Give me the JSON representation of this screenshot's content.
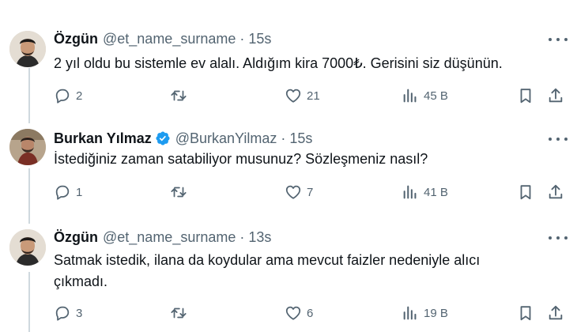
{
  "tweets": [
    {
      "name": "Özgün",
      "handle": "@et_name_surname",
      "dot": "·",
      "time": "15s",
      "verified": false,
      "text_lines": [
        "2 yıl oldu bu sistemle ev alalı. Aldığım kira 7000₺. Gerisini siz düşünün."
      ],
      "replies": "2",
      "retweets": "",
      "likes": "21",
      "views": "45 B"
    },
    {
      "name": "Burkan Yılmaz",
      "handle": "@BurkanYilmaz",
      "dot": "·",
      "time": "15s",
      "verified": true,
      "text_lines": [
        "İstediğiniz zaman satabiliyor musunuz? Sözleşmeniz nasıl?"
      ],
      "replies": "1",
      "retweets": "",
      "likes": "7",
      "views": "41 B"
    },
    {
      "name": "Özgün",
      "handle": "@et_name_surname",
      "dot": "·",
      "time": "13s",
      "verified": false,
      "text_lines": [
        "Satmak istedik, ilana da koydular ama  mevcut faizler nedeniyle alıcı",
        "çıkmadı."
      ],
      "replies": "3",
      "retweets": "",
      "likes": "6",
      "views": "19 B"
    }
  ],
  "icons": {
    "reply": "reply-icon",
    "retweet": "retweet-icon",
    "like": "heart-icon",
    "views": "views-icon",
    "bookmark": "bookmark-icon",
    "share": "share-icon",
    "more": "more-icon",
    "verified": "verified-badge-icon"
  },
  "colors": {
    "text": "#0f1419",
    "muted": "#536471",
    "verified": "#1d9bf0",
    "thread_line": "#cfd9de"
  }
}
